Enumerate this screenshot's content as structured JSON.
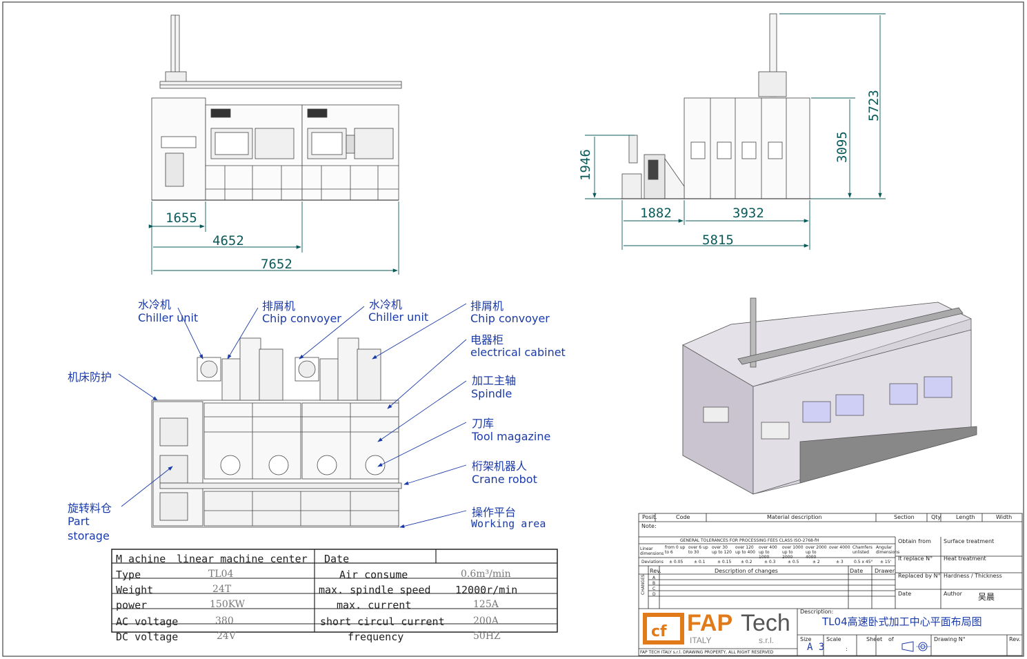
{
  "dimensions": {
    "front": [
      "1655",
      "4652",
      "7652"
    ],
    "side_h": [
      "1882",
      "3932",
      "5815"
    ],
    "side_v": [
      "1946",
      "3095",
      "5723"
    ]
  },
  "labels": {
    "chiller1_cn": "水冷机",
    "chiller1_en": "Chiller unit",
    "conv1_cn": "排屑机",
    "conv1_en": "Chip convoyer",
    "chiller2_cn": "水冷机",
    "chiller2_en": "Chiller unit",
    "conv2_cn": "排屑机",
    "conv2_en": "Chip convoyer",
    "cabinet_cn": "电器柜",
    "cabinet_en": "electrical cabinet",
    "guard_cn": "机床防护",
    "spindle_cn": "加工主轴",
    "spindle_en": "Spindle",
    "tool_cn": "刀库",
    "tool_en": "Tool magazine",
    "robot_cn": "桁架机器人",
    "robot_en": "Crane robot",
    "part_cn": "旋转料仓",
    "part_en1": "Part",
    "part_en2": "storage",
    "work_cn": "操作平台",
    "work_en": "Working area"
  },
  "spec": {
    "r1": [
      "M achine",
      "linear machine center",
      "Date",
      ""
    ],
    "r2": [
      "Type",
      "TL04",
      "Air consume",
      "0.6m³/min"
    ],
    "r3": [
      "Weight",
      "24T",
      "max. spindle speed",
      "12000r/min"
    ],
    "r4": [
      "power",
      "150KW",
      "max. current",
      "125A"
    ],
    "r5": [
      "AC voltage",
      "380",
      "short circul current",
      "200A"
    ],
    "r6": [
      "DC voltage",
      "24V",
      "frequency",
      "50HZ"
    ]
  },
  "titleblock": {
    "header": [
      "Posit.",
      "Code",
      "Material description",
      "Section",
      "Qty",
      "Length",
      "Width"
    ],
    "note": "Note:",
    "tolerance_title": "GENERAL TOLERANCES FOR PROCESSING FEES CLASS ISO-2768-fH",
    "linear": "Linear dimensions",
    "ranges": [
      "from 0 up to 6",
      "over 6 up to 30",
      "over 30 up to 120",
      "over 120 up to 400",
      "over 400 up to 1000",
      "over 1000 up to 2000",
      "over 2000 up to 4000",
      "over 4000"
    ],
    "deviations_label": "Deviations",
    "deviations": [
      "± 0.05",
      "± 0.1",
      "± 0.15",
      "± 0.2",
      "± 0.3",
      "± 0.5",
      "± 2",
      "± 3"
    ],
    "chamfers": "Chamfers unlisted",
    "angular": "Angular dimensions",
    "chamfer_val": "0.5 x 45°",
    "angular_val": "± 15'",
    "obtain": "Obtain from",
    "surface": "Surface treatment",
    "replace": "It replace N°",
    "heat": "Heat treatment",
    "replaced": "Replaced by N°",
    "hardness": "Hardness / Thickness",
    "date": "Date",
    "author": "Author",
    "author_name": "吴晨",
    "rev": "Rev.",
    "desc_changes": "Description of changes",
    "date2": "Date",
    "drawer": "Drawer",
    "changes": "CHANGES",
    "rev_rows": [
      "A",
      "B",
      "C",
      "D"
    ],
    "description_label": "Description:",
    "description": "TL04高速卧式加工中心平面布局图",
    "logo_fap": "FAP",
    "logo_tech": "Tech",
    "logo_italy": "ITALY",
    "logo_srl": "s.r.l.",
    "logo_sub": "FAP TECH ITALY s.r.l.  DRAWING PROPERTY, ALL RIGHT RESERVED",
    "size_label": "Size",
    "size_val": "A 3",
    "scale_label": "Scale",
    "scale_val": ":",
    "sheet_label": "Sheet",
    "of_label": "of",
    "drawing_label": "Drawing N°",
    "rev2": "Rev."
  },
  "colors": {
    "dim": "#0a5a5a",
    "label": "#1a3aa8",
    "line": "#333333",
    "logo_orange": "#e07a1a"
  }
}
